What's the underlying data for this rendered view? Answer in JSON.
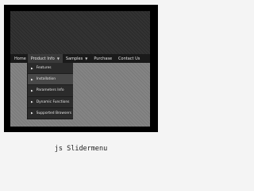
{
  "menubar": {
    "home": "Home",
    "items": [
      {
        "label": "Product Info",
        "arrow": "▼"
      },
      {
        "label": "Samples",
        "arrow": "▼"
      },
      {
        "label": "Purchase"
      },
      {
        "label": "Contact Us"
      }
    ]
  },
  "submenu": {
    "items": [
      {
        "label": "Features",
        "bullet": "▶"
      },
      {
        "label": "Installation",
        "bullet": "▶"
      },
      {
        "label": "Parameters Info",
        "bullet": "▶"
      },
      {
        "label": "Dynamic Functions",
        "bullet": "▶"
      },
      {
        "label": "Supported Browsers",
        "bullet": "▶"
      }
    ]
  },
  "caption": "js Slidermenu",
  "colors": {
    "frame": "#000000",
    "menubar": "#1a1a1a",
    "submenu": "#2b2b2b",
    "submenu_highlight": "#484848",
    "background": "#f4f4f4"
  }
}
